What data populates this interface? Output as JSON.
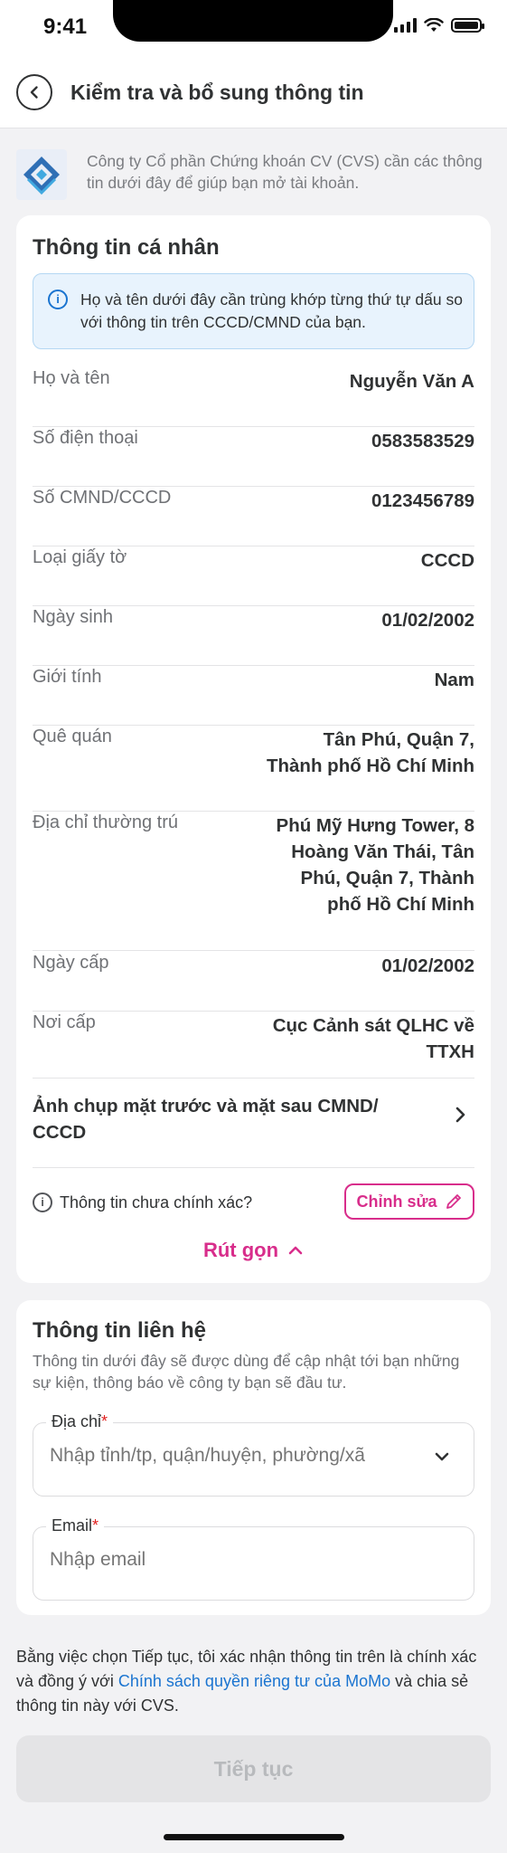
{
  "status_bar": {
    "time": "9:41"
  },
  "header": {
    "title": "Kiểm tra và bổ sung thông tin"
  },
  "intro": {
    "text": "Công ty Cổ phần Chứng khoán CV (CVS) cần các thông tin dưới đây để giúp bạn mở tài khoản."
  },
  "personal": {
    "title": "Thông tin cá nhân",
    "notice": "Họ và tên dưới đây cần trùng khớp từng thứ tự dấu so với thông tin trên CCCD/CMND của bạn.",
    "rows": [
      {
        "label": "Họ và tên",
        "value": "Nguyễn Văn A"
      },
      {
        "label": "Số điện thoại",
        "value": "0583583529"
      },
      {
        "label": "Số CMND/CCCD",
        "value": "0123456789"
      },
      {
        "label": "Loại giấy tờ",
        "value": "CCCD"
      },
      {
        "label": "Ngày sinh",
        "value": "01/02/2002"
      },
      {
        "label": "Giới tính",
        "value": "Nam"
      },
      {
        "label": "Quê quán",
        "value_lines": [
          "Tân Phú, Quận 7,",
          "Thành phố Hồ Chí Minh"
        ]
      },
      {
        "label": "Địa chỉ thường trú",
        "value_lines": [
          "Phú Mỹ Hưng Tower, 8",
          "Hoàng Văn Thái, Tân",
          "Phú, Quận 7, Thành",
          "phố Hồ Chí Minh"
        ]
      },
      {
        "label": "Ngày cấp",
        "value": "01/02/2002"
      },
      {
        "label": "Nơi cấp",
        "value_lines": [
          "Cục Cảnh sát QLHC về",
          "TTXH"
        ]
      }
    ],
    "photo_label_lines": [
      "Ảnh chụp mặt trước và mặt sau CMND/",
      "CCCD"
    ],
    "incorrect_text": "Thông tin chưa chính xác?",
    "edit_label": "Chỉnh sửa",
    "collapse_label": "Rút gọn"
  },
  "contact": {
    "title": "Thông tin liên hệ",
    "description": "Thông tin dưới đây sẽ được dùng để cập nhật tới bạn những sự kiện, thông báo về công ty bạn sẽ đầu tư.",
    "address": {
      "label": "Địa chỉ",
      "placeholder": "Nhập tỉnh/tp, quận/huyện, phường/xã"
    },
    "email": {
      "label": "Email",
      "placeholder": "Nhập email"
    },
    "required_mark": "*"
  },
  "consent": {
    "before": "Bằng việc chọn Tiếp tục, tôi xác nhận thông tin trên là chính xác và đồng ý với ",
    "link": "Chính sách quyền riêng tư của MoMo",
    "after": " và chia sẻ thông tin này với CVS."
  },
  "continue_label": "Tiếp tục",
  "colors": {
    "accent": "#d82d8b",
    "link": "#1a74d0",
    "info_bg": "#e8f3fd",
    "disabled_bg": "#e4e4e6"
  }
}
